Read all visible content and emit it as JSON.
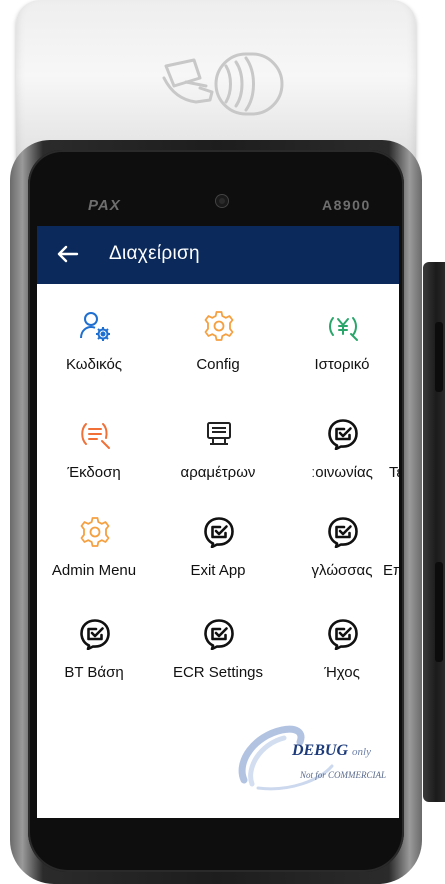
{
  "device": {
    "brand": "PAX",
    "model": "A8900"
  },
  "app_bar": {
    "back_icon": "arrow-left-icon",
    "title": "Διαχείριση",
    "color": "#0b2a5b"
  },
  "tiles": [
    {
      "label": "Κωδικός",
      "icon": "user-settings-icon",
      "color": "#1f6fd1"
    },
    {
      "label": "Config",
      "icon": "gear-icon",
      "color": "#f5a040"
    },
    {
      "label": "Ιστορικό",
      "icon": "yen-search-icon",
      "color": "#2aa66a"
    },
    {
      "label": "Έκδοση",
      "icon": "list-search-icon",
      "color": "#f07038"
    },
    {
      "label": "αραμέτρων",
      "icon": "printer-icon",
      "color": "#222222"
    },
    {
      "label": "ːοινωνίας",
      "icon": "check-bubble-icon",
      "color": "#111111"
    },
    {
      "label": "Τε",
      "icon": "check-bubble-icon",
      "color": "#111111"
    },
    {
      "label": "Admin Menu",
      "icon": "gear-icon",
      "color": "#f5a040"
    },
    {
      "label": "Exit App",
      "icon": "check-bubble-icon",
      "color": "#111111"
    },
    {
      "label": "γλώσσας",
      "icon": "check-bubble-icon",
      "color": "#111111"
    },
    {
      "label": "Επ",
      "icon": "check-bubble-icon",
      "color": "#111111"
    },
    {
      "label": "BT Βάση",
      "icon": "check-bubble-icon",
      "color": "#111111"
    },
    {
      "label": "ECR Settings",
      "icon": "check-bubble-icon",
      "color": "#111111"
    },
    {
      "label": "Ήχος",
      "icon": "check-bubble-icon",
      "color": "#111111"
    }
  ],
  "watermark": {
    "debug": "DEBUG",
    "only": "only",
    "note": "Not for COMMERCIAL"
  }
}
